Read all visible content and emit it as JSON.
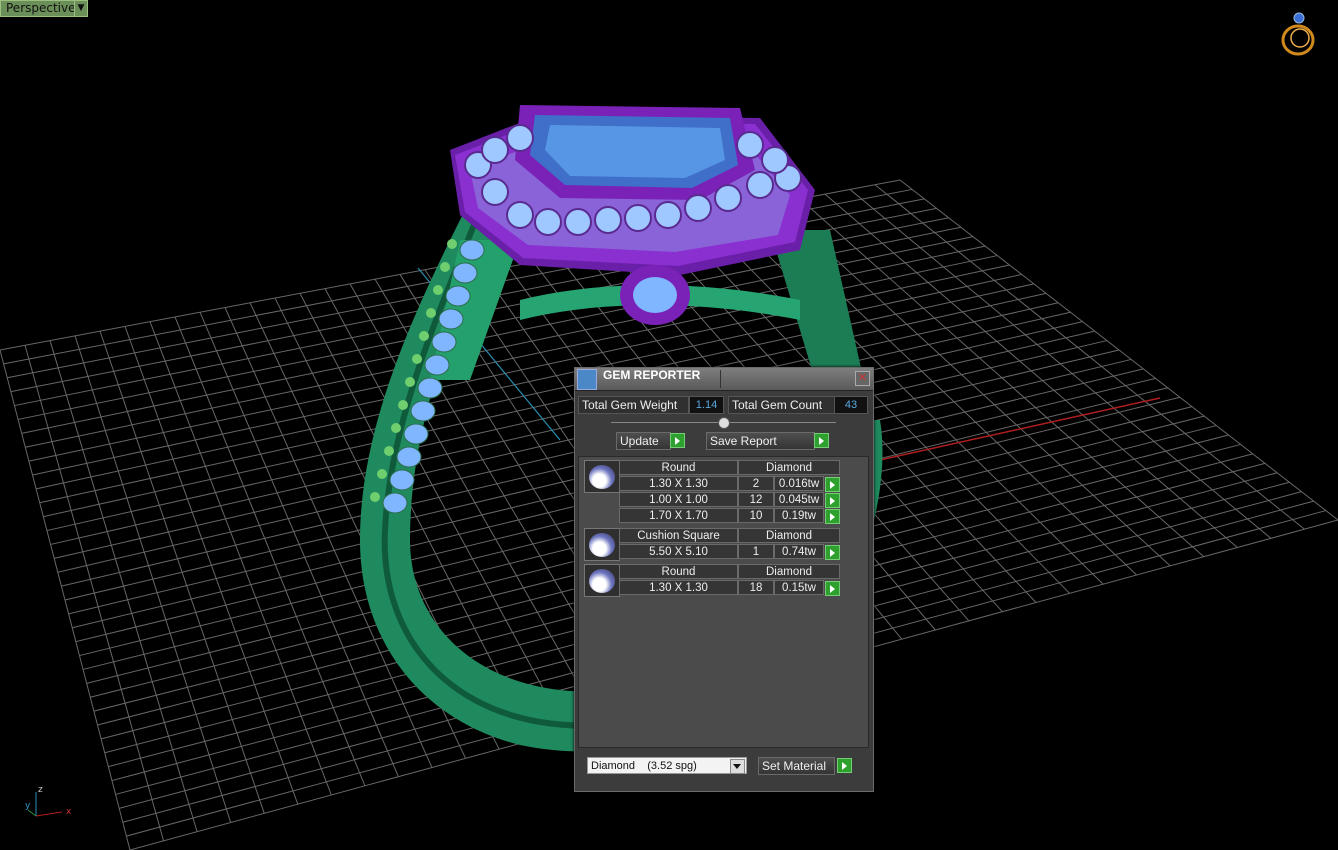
{
  "viewport": {
    "label": "Perspective",
    "grid_color": "#7a7a7a",
    "ring_metal_color": "#1f8a5e",
    "halo_color": "#7a22b8",
    "gem_color": "#7fb6ff"
  },
  "gem_reporter": {
    "title": "GEM REPORTER",
    "total_weight_label": "Total Gem Weight",
    "total_weight_value": "1.14",
    "total_count_label": "Total Gem Count",
    "total_count_value": "43",
    "update_label": "Update",
    "save_report_label": "Save Report",
    "groups": [
      {
        "shape": "Round",
        "material": "Diamond",
        "rows": [
          {
            "size": "1.30 X 1.30",
            "count": "2",
            "weight": "0.016tw"
          },
          {
            "size": "1.00 X 1.00",
            "count": "12",
            "weight": "0.045tw"
          },
          {
            "size": "1.70 X 1.70",
            "count": "10",
            "weight": "0.19tw"
          }
        ]
      },
      {
        "shape": "Cushion Square",
        "material": "Diamond",
        "rows": [
          {
            "size": "5.50 X 5.10",
            "count": "1",
            "weight": "0.74tw"
          }
        ]
      },
      {
        "shape": "Round",
        "material": "Diamond",
        "rows": [
          {
            "size": "1.30 X 1.30",
            "count": "18",
            "weight": "0.15tw"
          }
        ]
      }
    ],
    "material_select": "Diamond    (3.52 spg)",
    "set_material_label": "Set Material"
  },
  "axes": {
    "x": "x",
    "y": "y",
    "z": "z"
  }
}
